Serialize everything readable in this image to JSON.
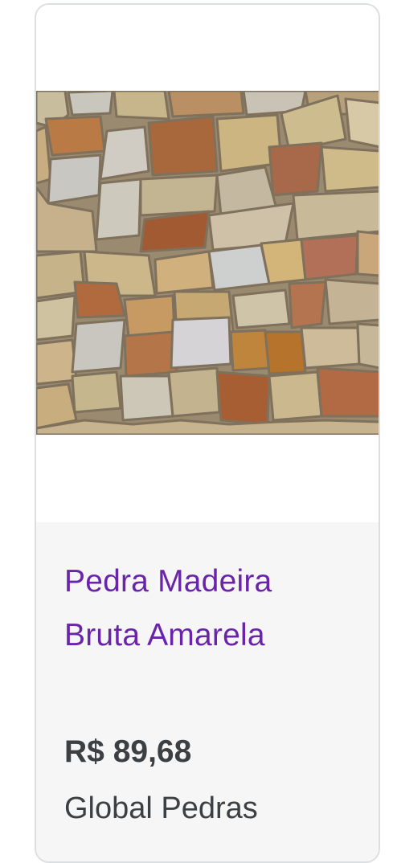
{
  "product": {
    "title": "Pedra Madeira Bruta Amarela",
    "price": "R$ 89,68",
    "seller": "Global Pedras",
    "image_name": "stone-wall-photo"
  },
  "colors": {
    "title": "#6a24a9",
    "text": "#3c4043",
    "info_bg": "#f6f6f7",
    "border": "#dcdfe2"
  }
}
